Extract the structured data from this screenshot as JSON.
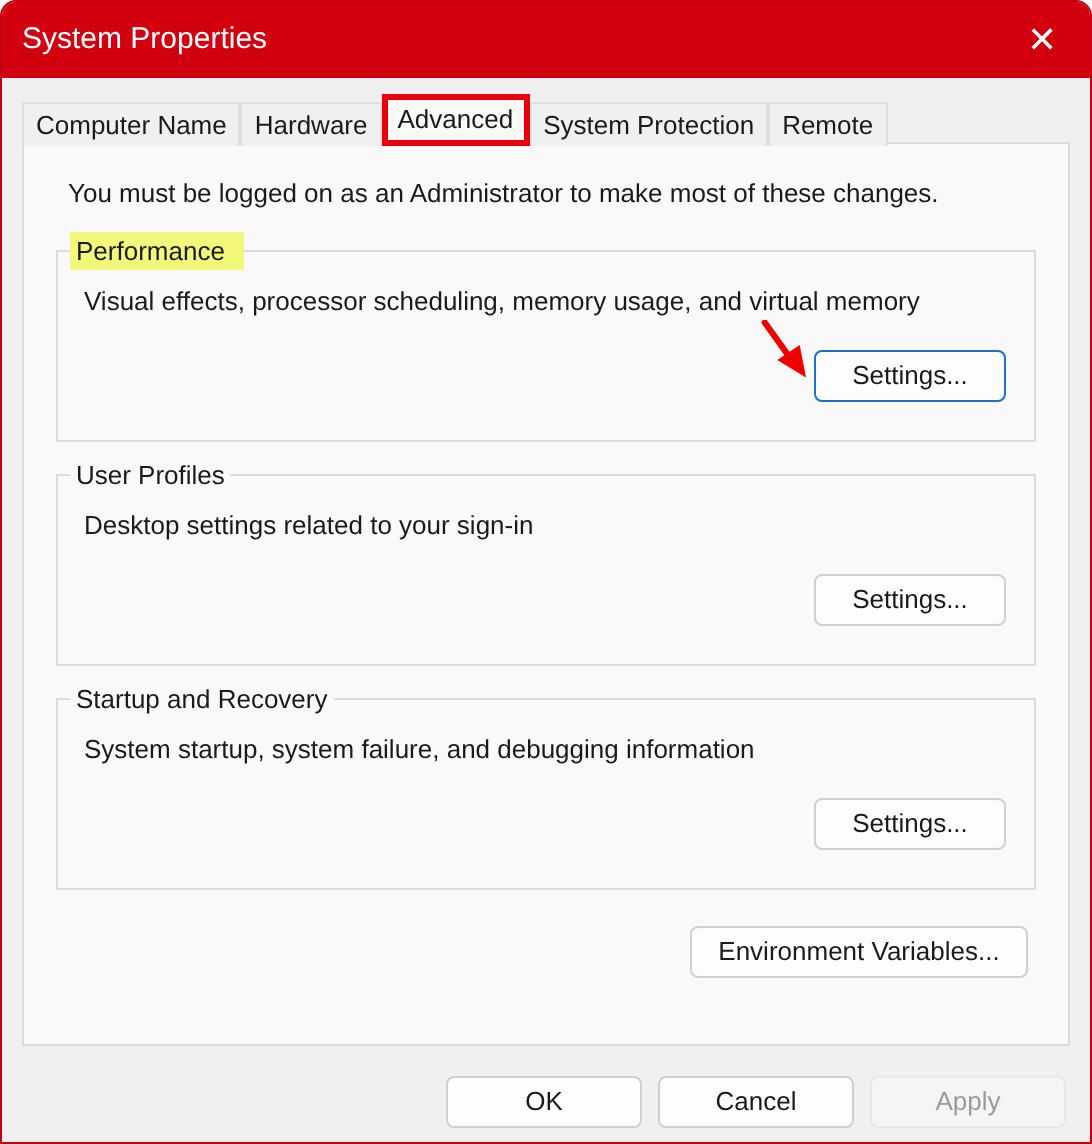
{
  "window": {
    "title": "System Properties",
    "close": "✕"
  },
  "tabs": [
    {
      "label": "Computer Name",
      "selected": false,
      "highlighted": false
    },
    {
      "label": "Hardware",
      "selected": false,
      "highlighted": false
    },
    {
      "label": "Advanced",
      "selected": true,
      "highlighted": true
    },
    {
      "label": "System Protection",
      "selected": false,
      "highlighted": false
    },
    {
      "label": "Remote",
      "selected": false,
      "highlighted": false
    }
  ],
  "notice": "You must be logged on as an Administrator to make most of these changes.",
  "groups": [
    {
      "title": "Performance",
      "highlighted": true,
      "description": "Visual effects, processor scheduling, memory usage, and virtual memory",
      "button": "Settings...",
      "focused": true,
      "arrow": true
    },
    {
      "title": "User Profiles",
      "highlighted": false,
      "description": "Desktop settings related to your sign-in",
      "button": "Settings...",
      "focused": false,
      "arrow": false
    },
    {
      "title": "Startup and Recovery",
      "highlighted": false,
      "description": "System startup, system failure, and debugging information",
      "button": "Settings...",
      "focused": false,
      "arrow": false
    }
  ],
  "environment_button": "Environment Variables...",
  "buttons": [
    {
      "label": "OK",
      "disabled": false
    },
    {
      "label": "Cancel",
      "disabled": false
    },
    {
      "label": "Apply",
      "disabled": true
    }
  ]
}
